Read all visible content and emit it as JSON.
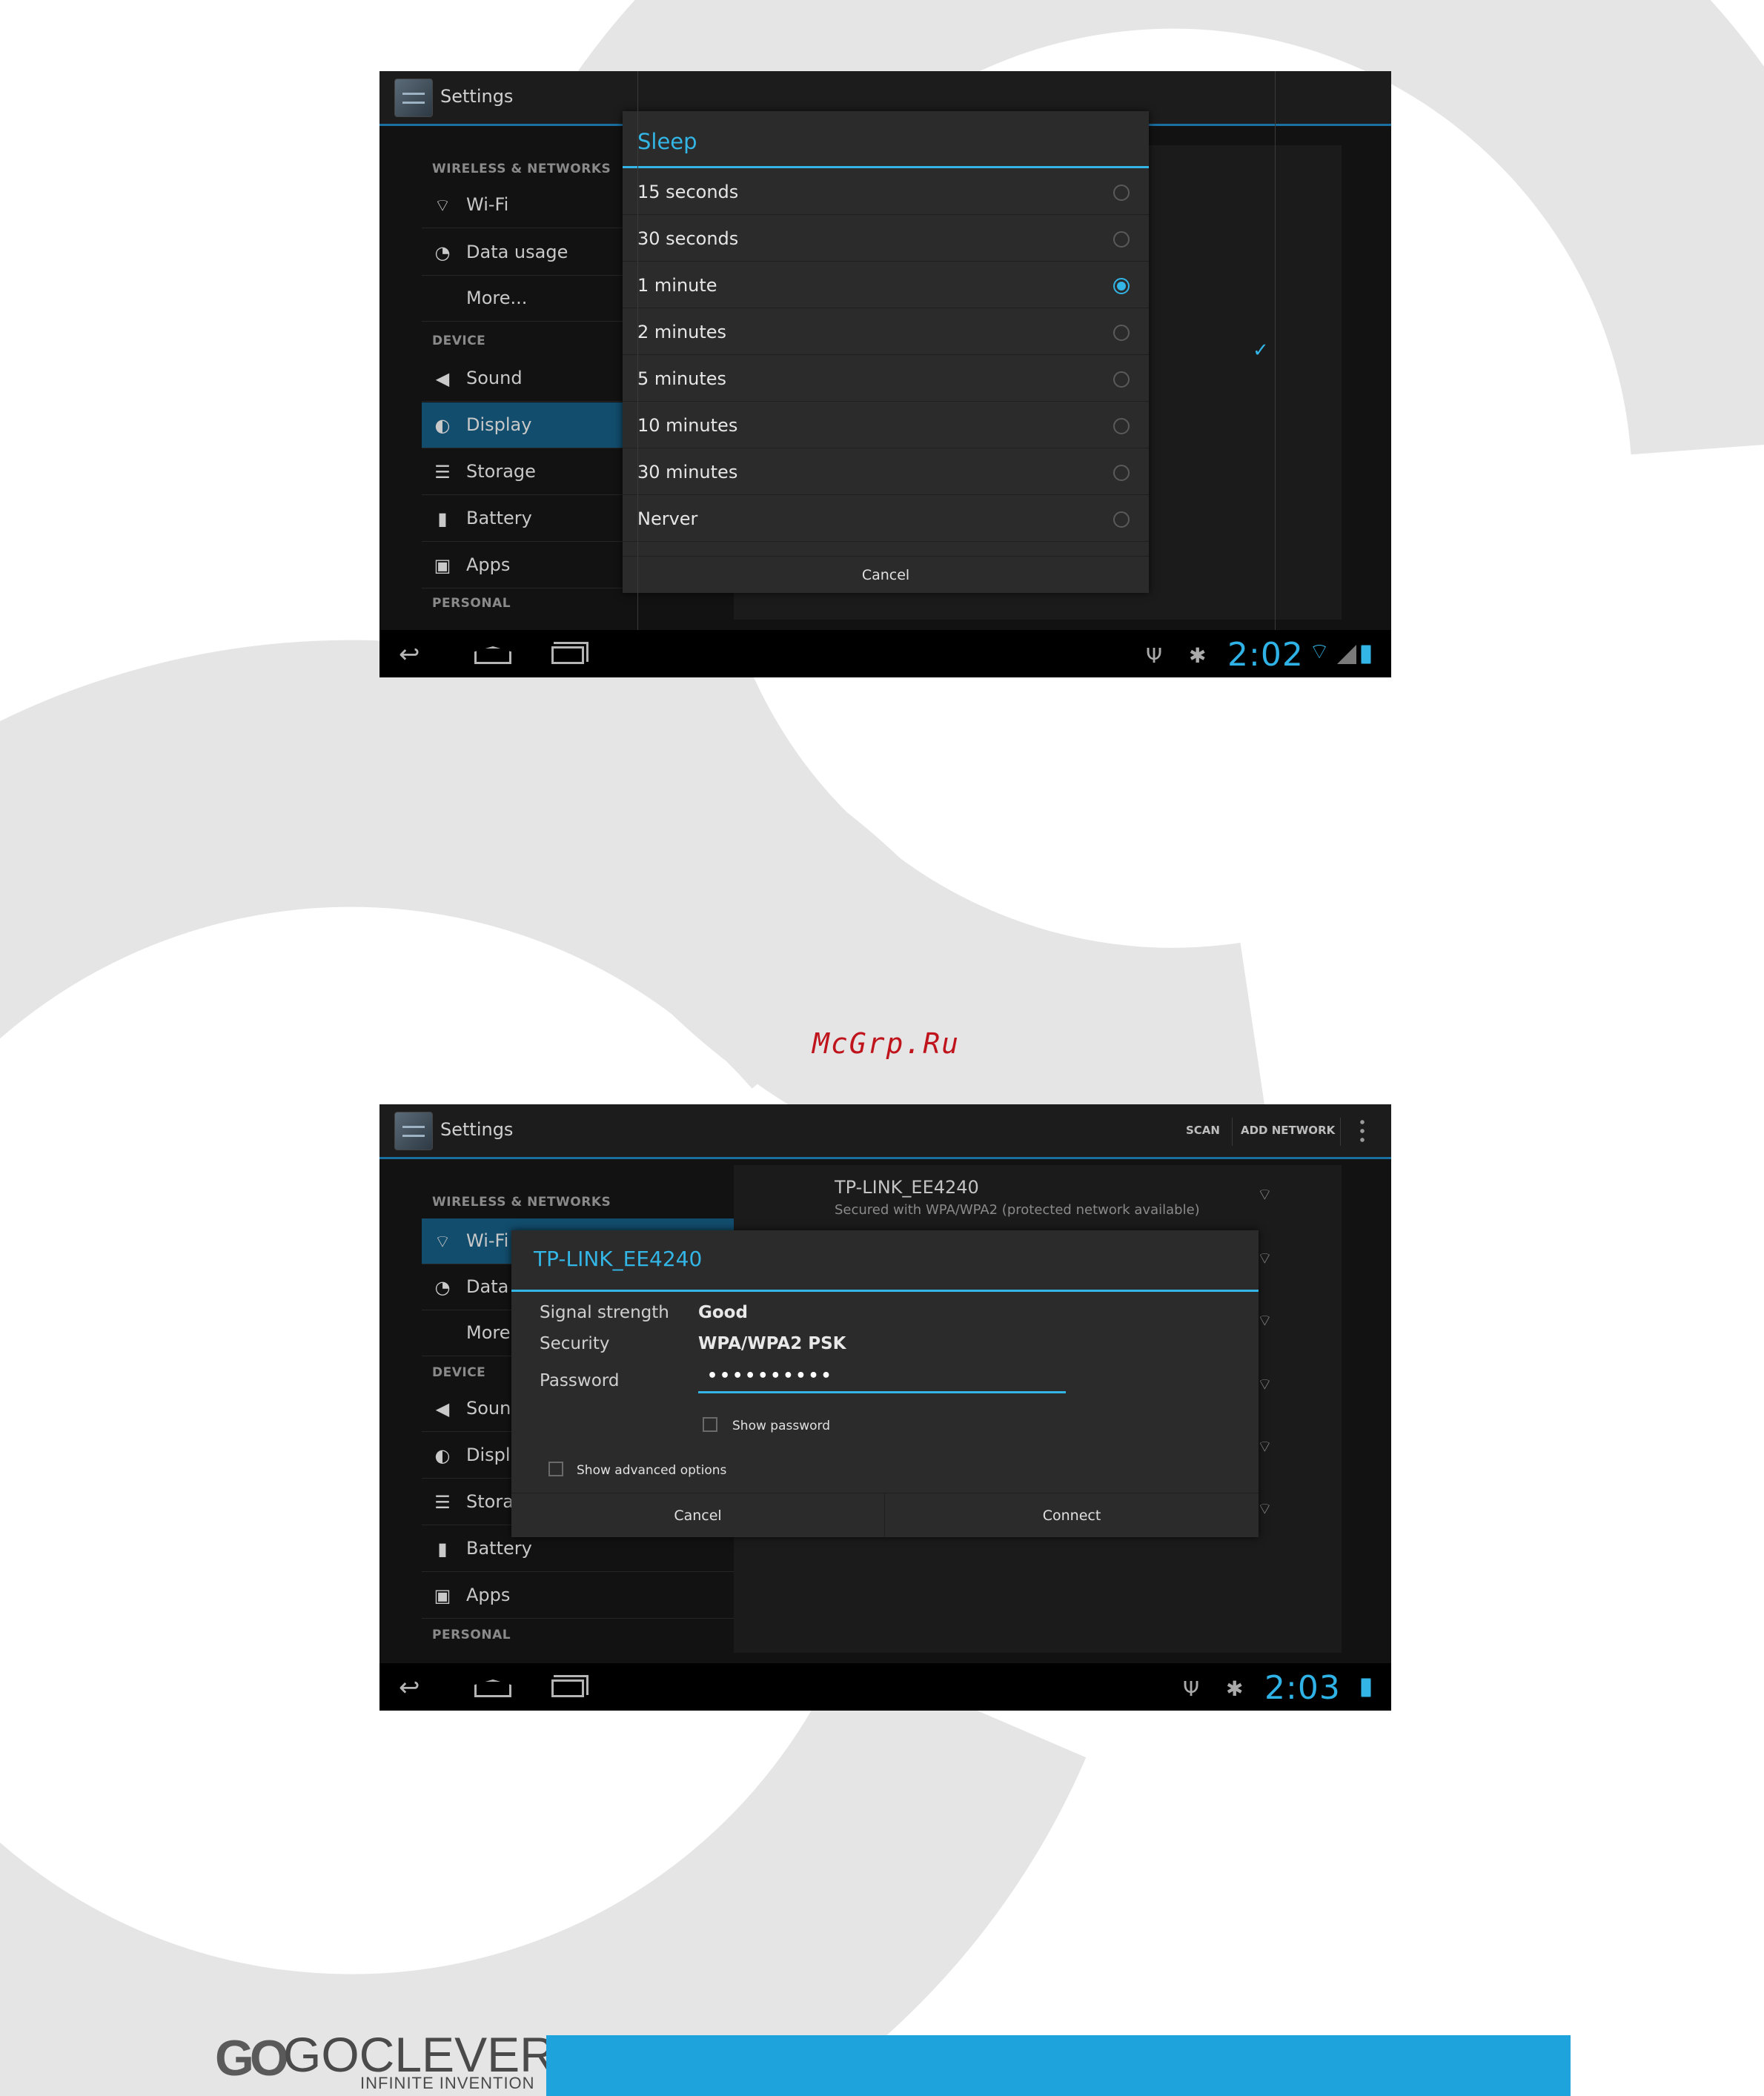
{
  "screen1": {
    "app_title": "Settings",
    "sections": {
      "wireless": "WIRELESS & NETWORKS",
      "device": "DEVICE",
      "personal": "PERSONAL"
    },
    "menu": [
      {
        "label": "Wi-Fi",
        "icon": "wifi-icon"
      },
      {
        "label": "Data usage",
        "icon": "data-usage-icon"
      },
      {
        "label": "More...",
        "icon": ""
      },
      {
        "label": "Sound",
        "icon": "speaker-icon"
      },
      {
        "label": "Display",
        "icon": "display-icon"
      },
      {
        "label": "Storage",
        "icon": "storage-icon"
      },
      {
        "label": "Battery",
        "icon": "battery-icon"
      },
      {
        "label": "Apps",
        "icon": "apps-icon"
      }
    ],
    "selected_item": "Display",
    "dialog": {
      "title": "Sleep",
      "options": [
        "15 seconds",
        "30 seconds",
        "1 minute",
        "2 minutes",
        "5 minutes",
        "10 minutes",
        "30 minutes",
        "Nerver"
      ],
      "selected": "1 minute",
      "cancel": "Cancel"
    },
    "clock": "2:02"
  },
  "screen2": {
    "app_title": "Settings",
    "action_scan": "SCAN",
    "action_add": "ADD NETWORK",
    "sections": {
      "wireless": "WIRELESS & NETWORKS",
      "device": "DEVICE",
      "personal": "PERSONAL"
    },
    "menu": [
      {
        "label": "Wi-Fi",
        "icon": "wifi-icon"
      },
      {
        "label": "Data",
        "icon": "data-usage-icon"
      },
      {
        "label": "More",
        "icon": ""
      },
      {
        "label": "Soun",
        "icon": "speaker-icon"
      },
      {
        "label": "Displ",
        "icon": "display-icon"
      },
      {
        "label": "Stora",
        "icon": "storage-icon"
      },
      {
        "label": "Battery",
        "icon": "battery-icon"
      },
      {
        "label": "Apps",
        "icon": "apps-icon"
      }
    ],
    "selected_item": "Wi-Fi",
    "network": {
      "name": "TP-LINK_EE4240",
      "status": "Secured with WPA/WPA2 (protected network available)"
    },
    "dialog": {
      "title": "TP-LINK_EE4240",
      "signal_label": "Signal strength",
      "signal_value": "Good",
      "security_label": "Security",
      "security_value": "WPA/WPA2 PSK",
      "password_label": "Password",
      "password_value": "••••••••••",
      "show_password": "Show password",
      "show_advanced": "Show advanced options",
      "cancel": "Cancel",
      "connect": "Connect"
    },
    "clock": "2:03"
  },
  "watermark_text": "McGrp.Ru",
  "footer": {
    "logo_mark": "GO",
    "logo_word": "GOCLEVER",
    "tagline": "INFINITE INVENTION"
  },
  "colors": {
    "accent": "#33b5e5",
    "footer_bar": "#1ea3dd",
    "watermark_red": "#c0141c",
    "selected_row": "#124d6d"
  }
}
